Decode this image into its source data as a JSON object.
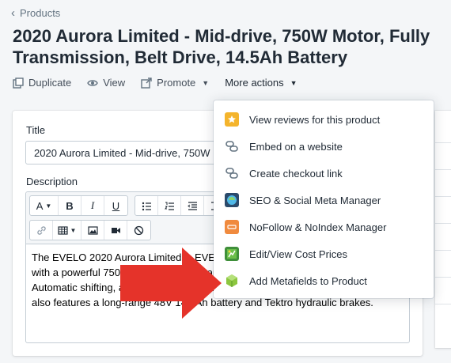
{
  "breadcrumb": {
    "label": "Products",
    "icon": "chevron-left-icon"
  },
  "page": {
    "title": "2020 Aurora Limited - Mid-drive, 750W Motor, Fully Automatic Transmission, Belt Drive, 14.5Ah Battery"
  },
  "actions": {
    "duplicate": "Duplicate",
    "view": "View",
    "promote": "Promote",
    "more": "More actions"
  },
  "form": {
    "title_label": "Title",
    "title_value": "2020 Aurora Limited - Mid-drive, 750W Motor, Fully Automatic Transmission, Belt Drive, 14.5Ah Battery",
    "description_label": "Description",
    "toolbar_row1": [
      "A",
      "B",
      "I",
      "U"
    ],
    "description_lines": [
      "The EVELO 2020 Aurora Limited is EVELO's most advanced eBike ever,",
      "with a powerful 750W mid-drive motor and revolutionary fully",
      "Automatic shifting, a belt drive for smooth, quiet rides. It",
      "also features a long-range 48V 14.5Ah battery and Tektro hydraulic brakes."
    ]
  },
  "menu": {
    "items": [
      {
        "label": "View reviews for this product",
        "icon": "star-icon",
        "color": "#f4b42c"
      },
      {
        "label": "Embed on a website",
        "icon": "embed-icon",
        "color": "#637381"
      },
      {
        "label": "Create checkout link",
        "icon": "link-icon",
        "color": "#637381"
      },
      {
        "label": "SEO & Social Meta Manager",
        "icon": "seo-icon",
        "color": "#2e9bd6"
      },
      {
        "label": "NoFollow & NoIndex Manager",
        "icon": "nofollow-icon",
        "color": "#f08a3e"
      },
      {
        "label": "Edit/View Cost Prices",
        "icon": "cost-icon",
        "color": "#3f8f3a"
      },
      {
        "label": "Add Metafields to Product",
        "icon": "metafields-icon",
        "color": "#5fb84a"
      }
    ]
  },
  "colors": {
    "arrow": "#e5332a",
    "accent": "#5c6ac4"
  }
}
